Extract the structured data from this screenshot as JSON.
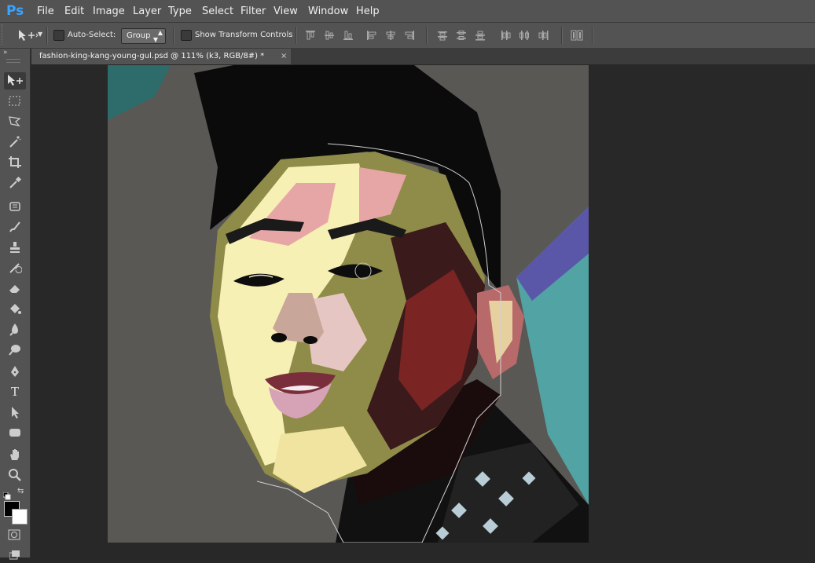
{
  "app": {
    "logo": "Ps"
  },
  "menu": [
    "File",
    "Edit",
    "Image",
    "Layer",
    "Type",
    "Select",
    "Filter",
    "View",
    "Window",
    "Help"
  ],
  "options": {
    "auto_select_label": "Auto-Select:",
    "auto_select_value": "Group",
    "transform_label": "Show Transform Controls"
  },
  "document": {
    "tab_title": "fashion-king-kang-young-gul.psd @ 111% (k3, RGB/8#) *",
    "close_glyph": "×"
  },
  "tools": [
    "move-icon",
    "marquee-icon",
    "lasso-icon",
    "magic-wand-icon",
    "crop-icon",
    "eyedropper-icon",
    "spot-healing-icon",
    "brush-icon",
    "clone-stamp-icon",
    "history-brush-icon",
    "eraser-icon",
    "paint-bucket-icon",
    "blur-icon",
    "dodge-icon",
    "pen-icon",
    "type-icon",
    "path-selection-icon",
    "shape-icon",
    "hand-icon",
    "zoom-icon"
  ],
  "type_tool_glyph": "T",
  "colors": {
    "foreground": "#000000",
    "background": "#ffffff",
    "accent": "#3ba3ff"
  }
}
